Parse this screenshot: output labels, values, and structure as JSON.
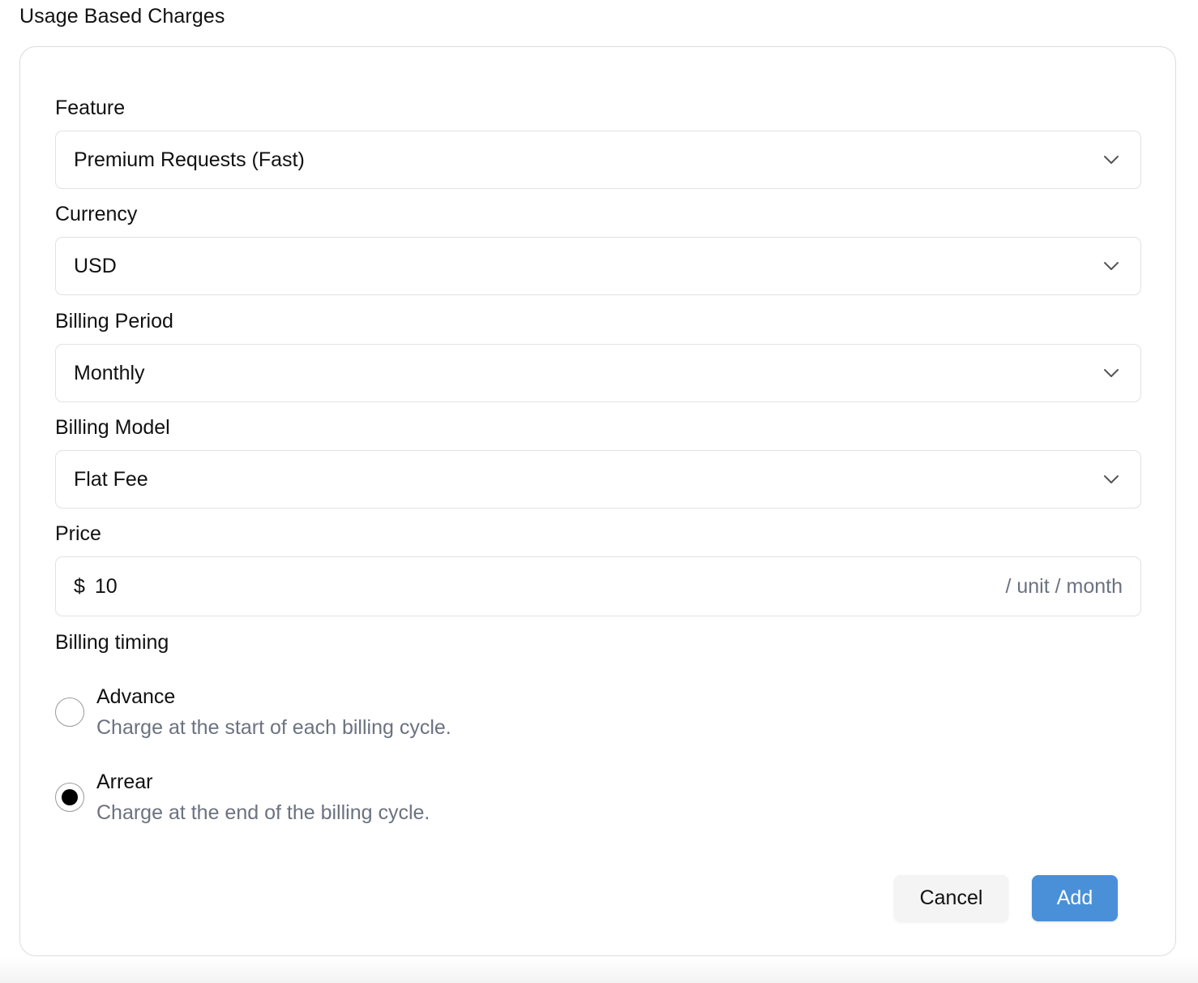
{
  "page": {
    "title": "Usage Based Charges"
  },
  "form": {
    "feature": {
      "label": "Feature",
      "value": "Premium Requests (Fast)",
      "icon": "chevron-down-icon"
    },
    "currency": {
      "label": "Currency",
      "value": "USD",
      "icon": "chevron-down-icon"
    },
    "billing_period": {
      "label": "Billing Period",
      "value": "Monthly",
      "icon": "chevron-down-icon"
    },
    "billing_model": {
      "label": "Billing Model",
      "value": "Flat Fee",
      "icon": "chevron-down-icon"
    },
    "price": {
      "label": "Price",
      "currency_symbol": "$",
      "value": "10",
      "suffix": "/ unit / month"
    },
    "billing_timing": {
      "label": "Billing timing",
      "selected": "Arrear",
      "options": [
        {
          "title": "Advance",
          "description": "Charge at the start of each billing cycle."
        },
        {
          "title": "Arrear",
          "description": "Charge at the end of the billing cycle."
        }
      ]
    }
  },
  "actions": {
    "cancel_label": "Cancel",
    "add_label": "Add"
  },
  "colors": {
    "primary_button": "#4a90d9",
    "muted_text": "#6b7280",
    "border": "#e2e2e2"
  }
}
